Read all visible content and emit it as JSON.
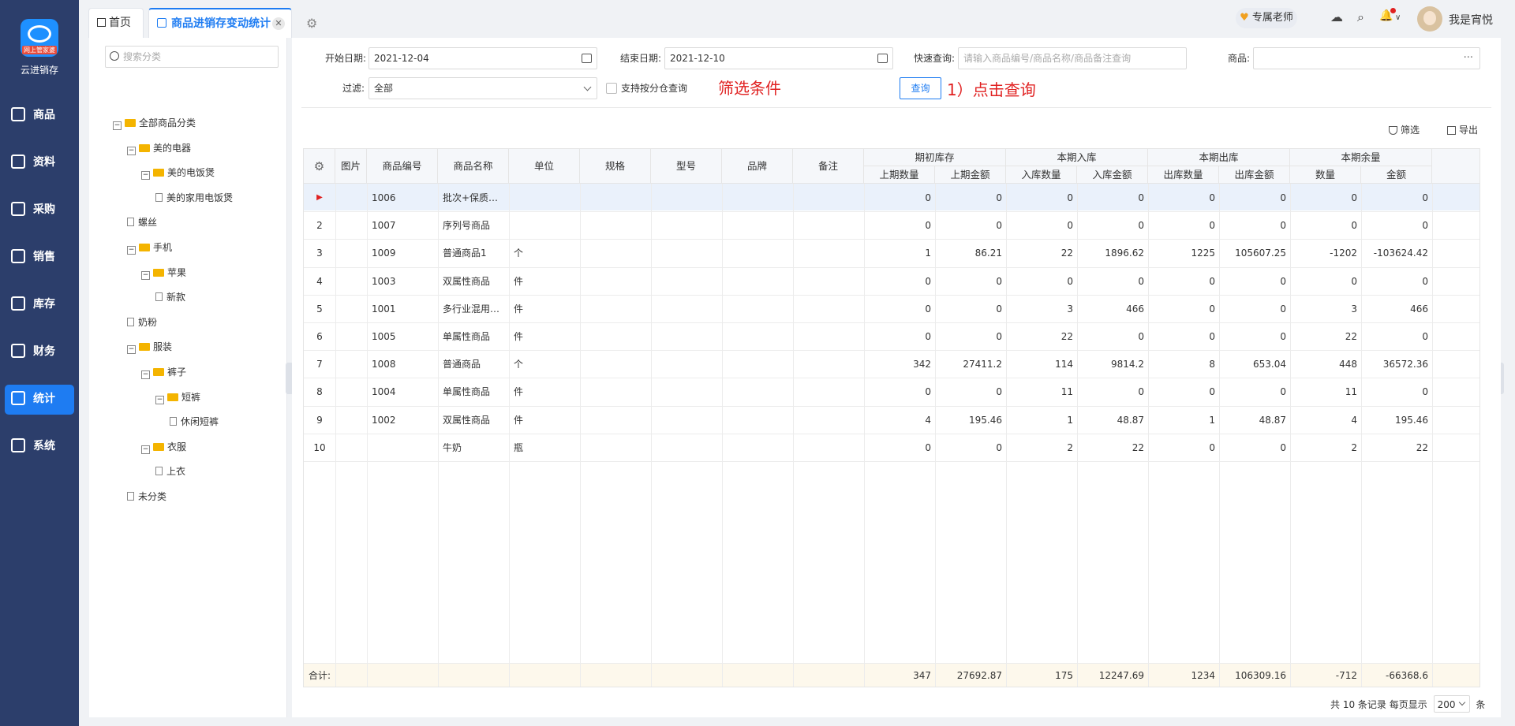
{
  "app": {
    "logo_tag": "网上管家婆",
    "brand": "云进销存"
  },
  "nav": [
    {
      "label": "商品",
      "icon": "bag-icon"
    },
    {
      "label": "资料",
      "icon": "file-icon"
    },
    {
      "label": "采购",
      "icon": "purchase-icon"
    },
    {
      "label": "销售",
      "icon": "sales-icon"
    },
    {
      "label": "库存",
      "icon": "warehouse-icon"
    },
    {
      "label": "财务",
      "icon": "finance-icon"
    },
    {
      "label": "统计",
      "icon": "chart-icon",
      "active": true
    },
    {
      "label": "系统",
      "icon": "settings-icon"
    }
  ],
  "tabs": {
    "home": "首页",
    "active": "商品进销存变动统计",
    "close": "✕",
    "gear": "⚙"
  },
  "header": {
    "teacher": "专属老师",
    "heart": "♥",
    "user": "我是宵悦",
    "cloud": "☁",
    "search": "⌕",
    "bell": "🔔",
    "bell_caret": "∨"
  },
  "categories": {
    "search_placeholder": "搜索分类",
    "tree": [
      {
        "label": "全部商品分类",
        "level": 0,
        "type": "folder",
        "toggle": "−"
      },
      {
        "label": "美的电器",
        "level": 1,
        "type": "folder",
        "toggle": "−"
      },
      {
        "label": "美的电饭煲",
        "level": 2,
        "type": "folder",
        "toggle": "−"
      },
      {
        "label": "美的家用电饭煲",
        "level": 3,
        "type": "file"
      },
      {
        "label": "螺丝",
        "level": 1,
        "type": "file"
      },
      {
        "label": "手机",
        "level": 1,
        "type": "folder",
        "toggle": "−"
      },
      {
        "label": "苹果",
        "level": 2,
        "type": "folder",
        "toggle": "−"
      },
      {
        "label": "新款",
        "level": 3,
        "type": "file"
      },
      {
        "label": "奶粉",
        "level": 1,
        "type": "file"
      },
      {
        "label": "服装",
        "level": 1,
        "type": "folder",
        "toggle": "−"
      },
      {
        "label": "裤子",
        "level": 2,
        "type": "folder",
        "toggle": "−"
      },
      {
        "label": "短裤",
        "level": 3,
        "type": "folder",
        "toggle": "−"
      },
      {
        "label": "休闲短裤",
        "level": 4,
        "type": "file"
      },
      {
        "label": "衣服",
        "level": 2,
        "type": "folder",
        "toggle": "−"
      },
      {
        "label": "上衣",
        "level": 3,
        "type": "file"
      },
      {
        "label": "未分类",
        "level": 1,
        "type": "file"
      }
    ]
  },
  "filters": {
    "start_label": "开始日期:",
    "start_value": "2021-12-04",
    "end_label": "结束日期:",
    "end_value": "2021-12-10",
    "quick_label": "快速查询:",
    "quick_placeholder": "请输入商品编号/商品名称/商品备注查询",
    "product_label": "商品:",
    "product_dots": "···",
    "filter_label": "过滤:",
    "filter_value": "全部",
    "split_warehouse": "支持按分仓查询",
    "annotation_filters": "筛选条件",
    "query_button": "查询",
    "annotation_query": "1）点击查询"
  },
  "toolbar": {
    "filter": "筛选",
    "export": "导出"
  },
  "table": {
    "headers": {
      "settings": "⚙",
      "image": "图片",
      "code": "商品编号",
      "name": "商品名称",
      "unit": "单位",
      "spec": "规格",
      "model": "型号",
      "brand": "品牌",
      "note": "备注",
      "g_open": "期初库存",
      "g_in": "本期入库",
      "g_out": "本期出库",
      "g_bal": "本期余量",
      "open_qty": "上期数量",
      "open_amt": "上期金额",
      "in_qty": "入库数量",
      "in_amt": "入库金额",
      "out_qty": "出库数量",
      "out_amt": "出库金额",
      "bal_qty": "数量",
      "bal_amt": "金额"
    },
    "rows": [
      {
        "idx": "▶",
        "code": "1006",
        "name": "批次+保质…",
        "unit": "",
        "open_qty": "0",
        "open_amt": "0",
        "in_qty": "0",
        "in_amt": "0",
        "out_qty": "0",
        "out_amt": "0",
        "bal_qty": "0",
        "bal_amt": "0"
      },
      {
        "idx": "2",
        "code": "1007",
        "name": "序列号商品",
        "unit": "",
        "open_qty": "0",
        "open_amt": "0",
        "in_qty": "0",
        "in_amt": "0",
        "out_qty": "0",
        "out_amt": "0",
        "bal_qty": "0",
        "bal_amt": "0"
      },
      {
        "idx": "3",
        "code": "1009",
        "name": "普通商品1",
        "unit": "个",
        "open_qty": "1",
        "open_amt": "86.21",
        "in_qty": "22",
        "in_amt": "1896.62",
        "out_qty": "1225",
        "out_amt": "105607.25",
        "bal_qty": "-1202",
        "bal_amt": "-103624.42"
      },
      {
        "idx": "4",
        "code": "1003",
        "name": "双属性商品",
        "unit": "件",
        "open_qty": "0",
        "open_amt": "0",
        "in_qty": "0",
        "in_amt": "0",
        "out_qty": "0",
        "out_amt": "0",
        "bal_qty": "0",
        "bal_amt": "0"
      },
      {
        "idx": "5",
        "code": "1001",
        "name": "多行业混用…",
        "unit": "件",
        "open_qty": "0",
        "open_amt": "0",
        "in_qty": "3",
        "in_amt": "466",
        "out_qty": "0",
        "out_amt": "0",
        "bal_qty": "3",
        "bal_amt": "466"
      },
      {
        "idx": "6",
        "code": "1005",
        "name": "单属性商品",
        "unit": "件",
        "open_qty": "0",
        "open_amt": "0",
        "in_qty": "22",
        "in_amt": "0",
        "out_qty": "0",
        "out_amt": "0",
        "bal_qty": "22",
        "bal_amt": "0"
      },
      {
        "idx": "7",
        "code": "1008",
        "name": "普通商品",
        "unit": "个",
        "open_qty": "342",
        "open_amt": "27411.2",
        "in_qty": "114",
        "in_amt": "9814.2",
        "out_qty": "8",
        "out_amt": "653.04",
        "bal_qty": "448",
        "bal_amt": "36572.36"
      },
      {
        "idx": "8",
        "code": "1004",
        "name": "单属性商品",
        "unit": "件",
        "open_qty": "0",
        "open_amt": "0",
        "in_qty": "11",
        "in_amt": "0",
        "out_qty": "0",
        "out_amt": "0",
        "bal_qty": "11",
        "bal_amt": "0"
      },
      {
        "idx": "9",
        "code": "1002",
        "name": "双属性商品",
        "unit": "件",
        "open_qty": "4",
        "open_amt": "195.46",
        "in_qty": "1",
        "in_amt": "48.87",
        "out_qty": "1",
        "out_amt": "48.87",
        "bal_qty": "4",
        "bal_amt": "195.46"
      },
      {
        "idx": "10",
        "code": "",
        "name": "牛奶",
        "unit": "瓶",
        "open_qty": "0",
        "open_amt": "0",
        "in_qty": "2",
        "in_amt": "22",
        "out_qty": "0",
        "out_amt": "0",
        "bal_qty": "2",
        "bal_amt": "22"
      }
    ],
    "totals": {
      "label": "合计:",
      "open_qty": "347",
      "open_amt": "27692.87",
      "in_qty": "175",
      "in_amt": "12247.69",
      "out_qty": "1234",
      "out_amt": "106309.16",
      "bal_qty": "-712",
      "bal_amt": "-66368.6"
    }
  },
  "pager": {
    "summary": "共 10 条记录",
    "per_page_label": "每页显示",
    "per_page_value": "200",
    "unit": "条"
  },
  "colors": {
    "sidebar": "#2c3e6b",
    "accent": "#1e7cf2",
    "annotation": "#e02020",
    "row_marker": "#e02020"
  }
}
